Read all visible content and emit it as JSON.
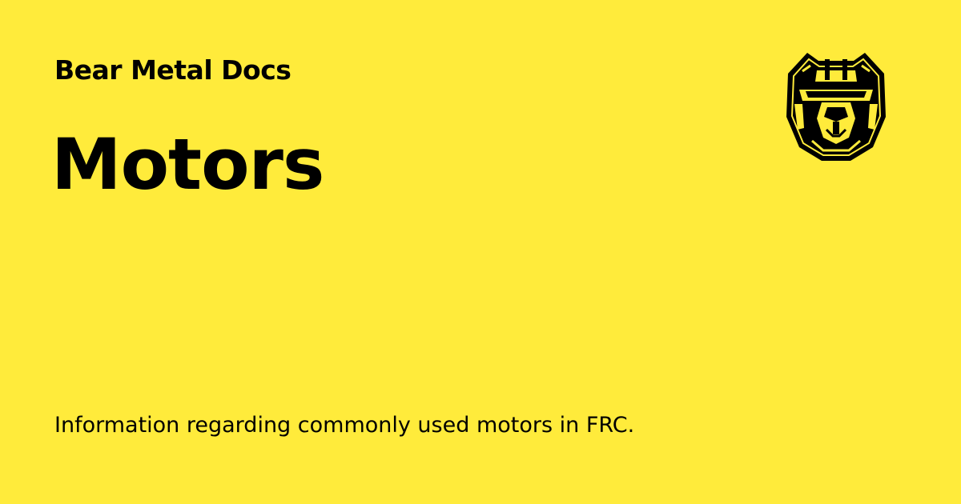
{
  "site": {
    "name": "Bear Metal Docs"
  },
  "page": {
    "title": "Motors",
    "description": "Information regarding commonly used motors in FRC."
  },
  "logo": {
    "icon": "bear-head-icon"
  },
  "colors": {
    "background": "#FFEB3B",
    "text": "#000000"
  }
}
